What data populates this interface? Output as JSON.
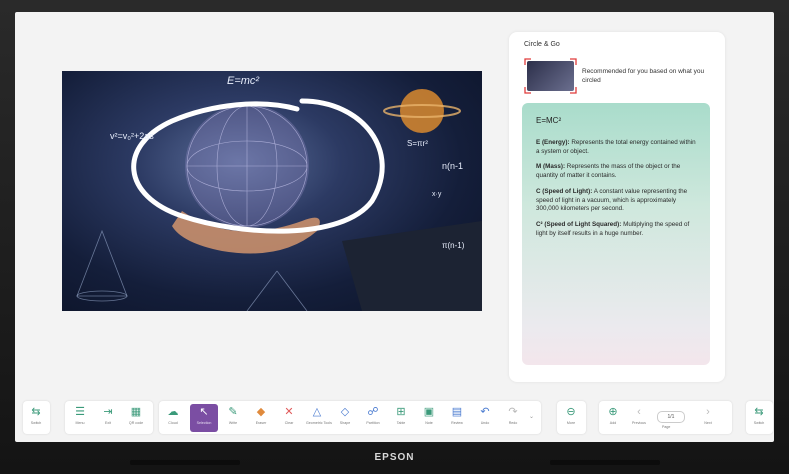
{
  "brand": "EPSON",
  "panel": {
    "title": "Circle & Go",
    "recommend_text": "Recommended for you based on what you circled",
    "card": {
      "title": "E=MC²",
      "items": [
        {
          "term": "E (Energy):",
          "desc": " Represents the total energy contained within a system or object."
        },
        {
          "term": "M (Mass):",
          "desc": " Represents the mass of the object or the quantity of matter it contains."
        },
        {
          "term": "C (Speed of Light):",
          "desc": " A constant value representing the speed of light in a vacuum, which is approximately 300,000 kilometers per second."
        },
        {
          "term": "C² (Speed of Light Squared):",
          "desc": " Multiplying the speed of light by itself results in a huge number."
        }
      ]
    }
  },
  "photo": {
    "overlay_texts": [
      "v²=v₀²+2as",
      "E=mc²",
      "S=πr²",
      "n(n-1",
      "x·y",
      "π(n-1)"
    ]
  },
  "toolbar": {
    "left_group": [
      {
        "label": "Switch",
        "icon": "switch-icon"
      }
    ],
    "main_group": [
      {
        "label": "Menu",
        "icon": "menu-icon"
      },
      {
        "label": "Exit",
        "icon": "exit-icon"
      },
      {
        "label": "QR code",
        "icon": "qr-code-icon"
      }
    ],
    "tools_group": [
      {
        "label": "Cloud",
        "icon": "cloud-icon"
      },
      {
        "label": "Selection",
        "icon": "selection-icon"
      },
      {
        "label": "Write",
        "icon": "pen-icon"
      },
      {
        "label": "Eraser",
        "icon": "eraser-icon"
      },
      {
        "label": "Clear",
        "icon": "clear-icon"
      },
      {
        "label": "Geometric Tools",
        "icon": "geometry-icon"
      },
      {
        "label": "Shape",
        "icon": "shape-icon"
      },
      {
        "label": "Partition",
        "icon": "partition-icon"
      },
      {
        "label": "Table",
        "icon": "table-icon"
      },
      {
        "label": "Note",
        "icon": "note-icon"
      },
      {
        "label": "Review",
        "icon": "review-icon"
      },
      {
        "label": "Undo",
        "icon": "undo-icon"
      },
      {
        "label": "Redo",
        "icon": "redo-icon"
      }
    ],
    "more": {
      "label": "More",
      "icon": "more-icon"
    },
    "page_group": {
      "add": {
        "label": "Add",
        "icon": "add-icon"
      },
      "previous": {
        "label": "Previous",
        "icon": "chevron-left-icon"
      },
      "page": "1/1",
      "page_label": "Page",
      "next": {
        "label": "Next",
        "icon": "chevron-right-icon"
      }
    },
    "right_group": [
      {
        "label": "Switch",
        "icon": "switch-icon"
      }
    ]
  },
  "colors": {
    "accent": "#7b4ea3",
    "tool_icon": "#3b9a7a",
    "card_top": "#a9dccb"
  }
}
